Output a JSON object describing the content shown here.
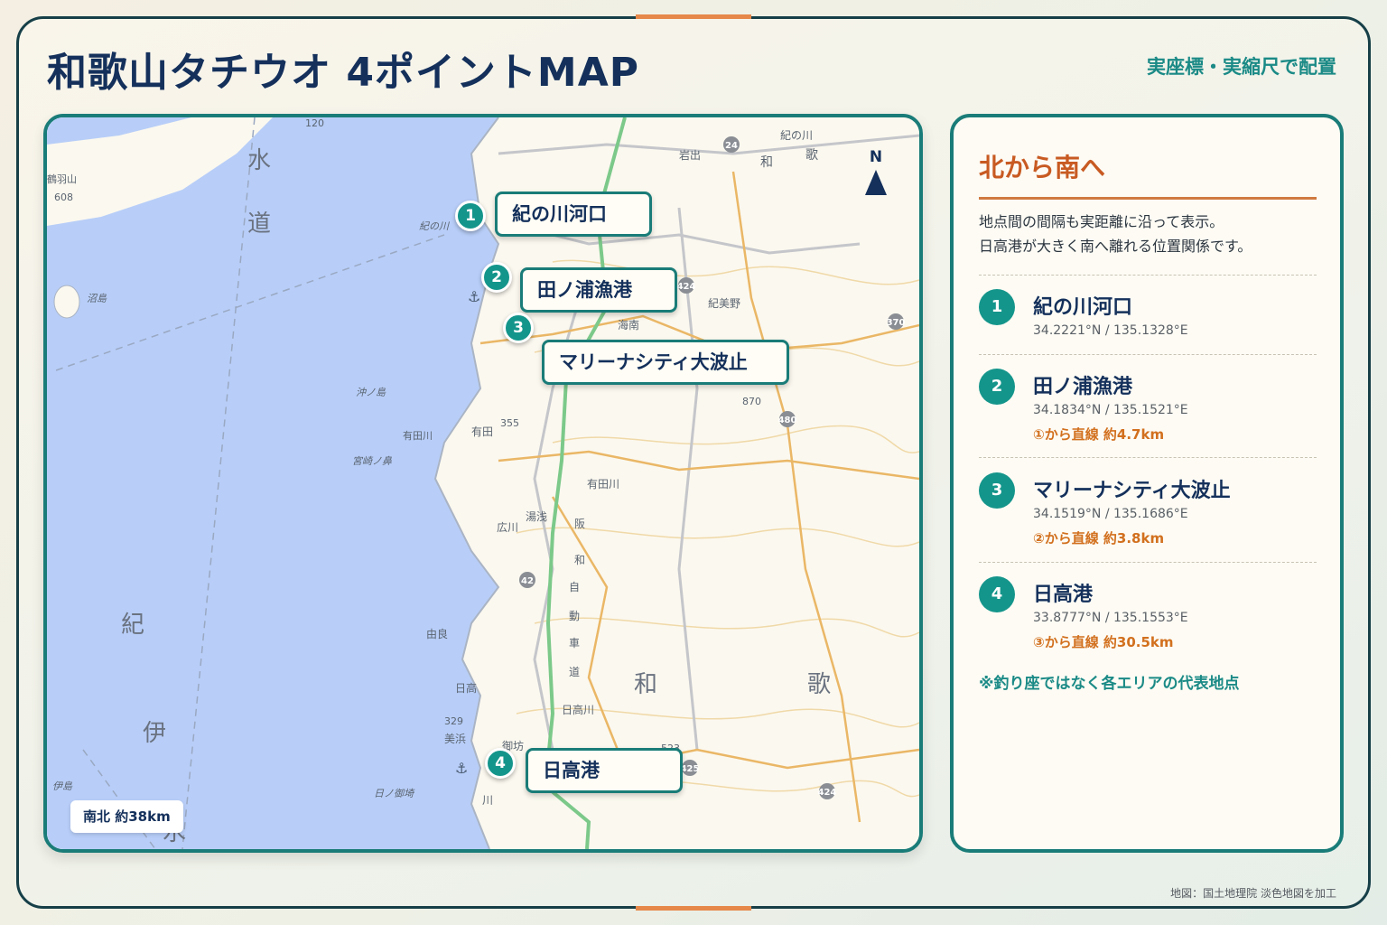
{
  "title": "和歌山タチウオ 4ポイントMAP",
  "subtitle": "実座標・実縮尺で配置",
  "map": {
    "north_label": "N",
    "scale_label": "南北 約38km",
    "credit": "地図：国土地理院 淡色地図を加工",
    "place_labels": [
      "水",
      "道",
      "紀",
      "伊",
      "水",
      "和",
      "歌",
      "紀の川",
      "和",
      "歌",
      "岩出",
      "紀美野",
      "海南",
      "有田",
      "有田川",
      "有田川",
      "湯浅",
      "広川",
      "由良",
      "日高",
      "日高川",
      "美浜",
      "御坊",
      "沼島",
      "沖ノ島",
      "宮崎ノ鼻",
      "伊島",
      "日ノ御埼",
      "阪",
      "和",
      "自",
      "動",
      "車",
      "道",
      "鶴羽山",
      "紀の川",
      "川"
    ],
    "elevations": [
      "120",
      "608",
      "355",
      "870",
      "329",
      "523"
    ],
    "route_numbers": [
      "24",
      "424",
      "370",
      "480",
      "42",
      "425",
      "424"
    ],
    "colors": {
      "sea": "#b8cef8",
      "land": "#fbf8ef",
      "expressway": "#7cc98a",
      "marker": "#14958b",
      "frame": "#1a7c78"
    }
  },
  "points": [
    {
      "num": "1",
      "name": "紀の川河口",
      "lat": 34.2221,
      "lon": 135.1328,
      "coord_text": "34.2221°N / 135.1328°E",
      "distance_text": ""
    },
    {
      "num": "2",
      "name": "田ノ浦漁港",
      "lat": 34.1834,
      "lon": 135.1521,
      "coord_text": "34.1834°N / 135.1521°E",
      "distance_text": "①から直線 約4.7km"
    },
    {
      "num": "3",
      "name": "マリーナシティ大波止",
      "lat": 34.1519,
      "lon": 135.1686,
      "coord_text": "34.1519°N / 135.1686°E",
      "distance_text": "②から直線 約3.8km"
    },
    {
      "num": "4",
      "name": "日高港",
      "lat": 33.8777,
      "lon": 135.1553,
      "coord_text": "33.8777°N / 135.1553°E",
      "distance_text": "③から直線 約30.5km"
    }
  ],
  "side": {
    "heading": "北から南へ",
    "desc_line1": "地点間の間隔も実距離に沿って表示。",
    "desc_line2": "日高港が大きく南へ離れる位置関係です。",
    "note": "※釣り座ではなく各エリアの代表地点"
  }
}
